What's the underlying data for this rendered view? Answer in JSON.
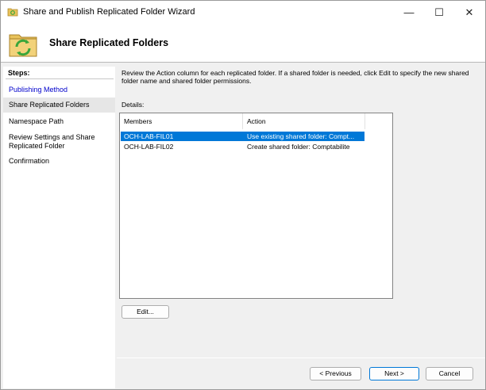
{
  "window": {
    "title": "Share and Publish Replicated Folder Wizard",
    "controls": {
      "minimize": "—",
      "maximize": "☐",
      "close": "✕"
    }
  },
  "header": {
    "title": "Share Replicated Folders"
  },
  "steps": {
    "heading": "Steps:",
    "items": [
      {
        "label": "Publishing Method",
        "state": "done"
      },
      {
        "label": "Share Replicated Folders",
        "state": "current"
      },
      {
        "label": "Namespace Path",
        "state": "pending"
      },
      {
        "label": "Review Settings and Share Replicated Folder",
        "state": "pending"
      },
      {
        "label": "Confirmation",
        "state": "pending"
      }
    ]
  },
  "main": {
    "description": "Review the Action column for each replicated folder. If a shared folder is needed, click Edit to specify the new shared folder name and shared folder permissions.",
    "details_label": "Details:",
    "columns": [
      "Members",
      "Action"
    ],
    "rows": [
      {
        "member": "OCH-LAB-FIL01",
        "action": "Use existing shared folder: Compt...",
        "selected": true
      },
      {
        "member": "OCH-LAB-FIL02",
        "action": "Create shared folder: Comptabilite",
        "selected": false
      }
    ],
    "edit_label": "Edit..."
  },
  "footer": {
    "previous_label": "< Previous",
    "next_label": "Next >",
    "cancel_label": "Cancel"
  },
  "colors": {
    "selection": "#0078d7",
    "link": "#0000cc",
    "accent_green": "#3aa63a",
    "folder_yellow": "#e8c25a"
  }
}
